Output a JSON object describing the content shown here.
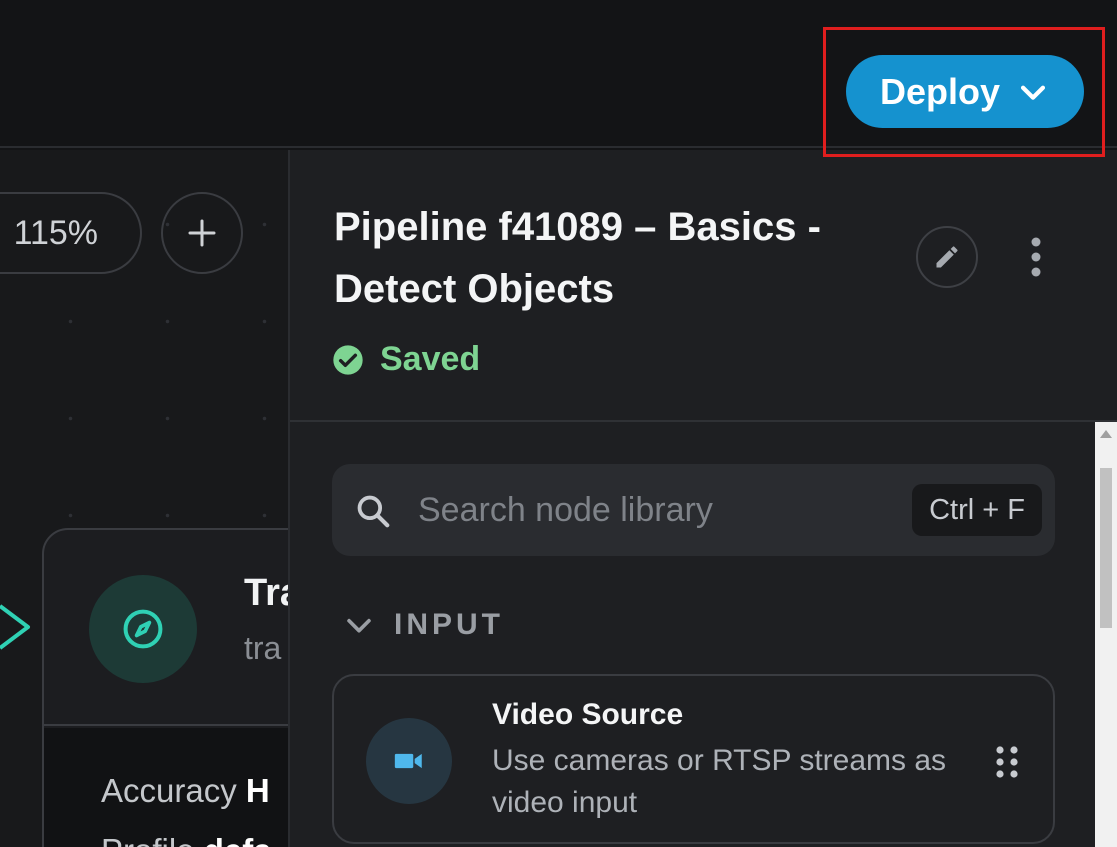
{
  "topbar": {
    "deploy_label": "Deploy"
  },
  "canvas": {
    "zoom_level": "115%",
    "node": {
      "title": "Tra",
      "subtitle": "tra",
      "props": [
        {
          "label": "Accuracy",
          "value": "H"
        },
        {
          "label": "Profile",
          "value": "defa"
        }
      ]
    }
  },
  "panel": {
    "pipeline_title": "Pipeline f41089 – Basics - Detect Objects",
    "status": "Saved",
    "search": {
      "placeholder": "Search node library",
      "shortcut": "Ctrl + F"
    },
    "section": {
      "label": "INPUT"
    },
    "library_item": {
      "title": "Video Source",
      "description": "Use cameras or RTSP streams as video input"
    }
  },
  "colors": {
    "accent": "#1592cf",
    "saved_green": "#7ed492",
    "highlight_red": "#e01e1e",
    "node_teal": "#2fd1b4"
  }
}
